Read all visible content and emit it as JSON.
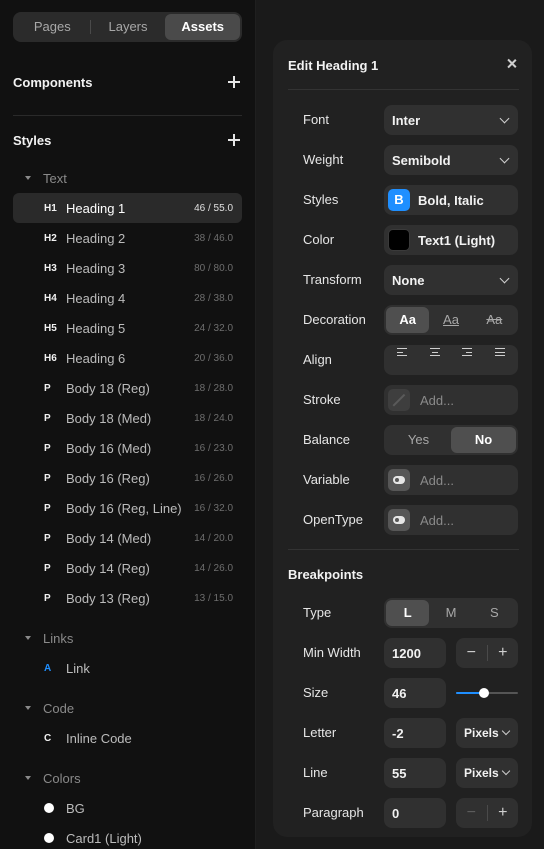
{
  "tabs": [
    {
      "label": "Pages",
      "active": false
    },
    {
      "label": "Layers",
      "active": false
    },
    {
      "label": "Assets",
      "active": true
    }
  ],
  "components": {
    "title": "Components"
  },
  "styles": {
    "title": "Styles",
    "text_group": "Text",
    "text_styles": [
      {
        "tag": "H1",
        "name": "Heading 1",
        "meta": "46 / 55.0",
        "selected": true
      },
      {
        "tag": "H2",
        "name": "Heading 2",
        "meta": "38 / 46.0"
      },
      {
        "tag": "H3",
        "name": "Heading 3",
        "meta": "80 / 80.0"
      },
      {
        "tag": "H4",
        "name": "Heading 4",
        "meta": "28 / 38.0"
      },
      {
        "tag": "H5",
        "name": "Heading 5",
        "meta": "24 / 32.0"
      },
      {
        "tag": "H6",
        "name": "Heading 6",
        "meta": "20 / 36.0"
      },
      {
        "tag": "P",
        "name": "Body 18 (Reg)",
        "meta": "18 / 28.0"
      },
      {
        "tag": "P",
        "name": "Body 18 (Med)",
        "meta": "18 / 24.0"
      },
      {
        "tag": "P",
        "name": "Body 16 (Med)",
        "meta": "16 / 23.0"
      },
      {
        "tag": "P",
        "name": "Body 16 (Reg)",
        "meta": "16 / 26.0"
      },
      {
        "tag": "P",
        "name": "Body 16 (Reg, Line)",
        "meta": "16 / 32.0"
      },
      {
        "tag": "P",
        "name": "Body 14 (Med)",
        "meta": "14 / 20.0"
      },
      {
        "tag": "P",
        "name": "Body 14 (Reg)",
        "meta": "14 / 26.0"
      },
      {
        "tag": "P",
        "name": "Body 13 (Reg)",
        "meta": "13 / 15.0"
      }
    ],
    "links_group": "Links",
    "link_item": {
      "tag": "A",
      "name": "Link",
      "tag_color": "#1f8fff"
    },
    "code_group": "Code",
    "code_item": {
      "tag": "C",
      "name": "Inline Code"
    },
    "colors_group": "Colors",
    "color_items": [
      {
        "name": "BG",
        "color": "#ffffff"
      },
      {
        "name": "Card1 (Light)",
        "color": "#ffffff"
      }
    ]
  },
  "editor": {
    "title": "Edit Heading 1",
    "font": {
      "label": "Font",
      "value": "Inter"
    },
    "weight": {
      "label": "Weight",
      "value": "Semibold"
    },
    "styles": {
      "label": "Styles",
      "value": "Bold, Italic",
      "icon": "B"
    },
    "color": {
      "label": "Color",
      "value": "Text1 (Light)",
      "swatch": "#000000"
    },
    "transform": {
      "label": "Transform",
      "value": "None"
    },
    "decoration": {
      "label": "Decoration",
      "options": [
        "Aa",
        "Aa",
        "Aa"
      ],
      "selected": 0
    },
    "align": {
      "label": "Align",
      "options": [
        "align-left-icon",
        "align-center-icon",
        "align-right-icon",
        "align-justify-icon"
      ]
    },
    "stroke": {
      "label": "Stroke",
      "placeholder": "Add..."
    },
    "balance": {
      "label": "Balance",
      "options": [
        "Yes",
        "No"
      ],
      "selected": 1
    },
    "variable": {
      "label": "Variable",
      "placeholder": "Add..."
    },
    "opentype": {
      "label": "OpenType",
      "placeholder": "Add..."
    }
  },
  "breakpoints": {
    "title": "Breakpoints",
    "type": {
      "label": "Type",
      "options": [
        "L",
        "M",
        "S"
      ],
      "selected": 0
    },
    "min_width": {
      "label": "Min Width",
      "value": "1200",
      "minus": "−",
      "plus": "+"
    },
    "size": {
      "label": "Size",
      "value": "46",
      "slider_fraction": 0.45
    },
    "letter": {
      "label": "Letter",
      "value": "-2",
      "unit": "Pixels"
    },
    "line": {
      "label": "Line",
      "value": "55",
      "unit": "Pixels"
    },
    "paragraph": {
      "label": "Paragraph",
      "value": "0",
      "minus": "−",
      "plus": "+"
    }
  },
  "colors": {
    "accent": "#1f8fff",
    "panel_bg": "#212121",
    "sidebar_bg": "#111111"
  }
}
